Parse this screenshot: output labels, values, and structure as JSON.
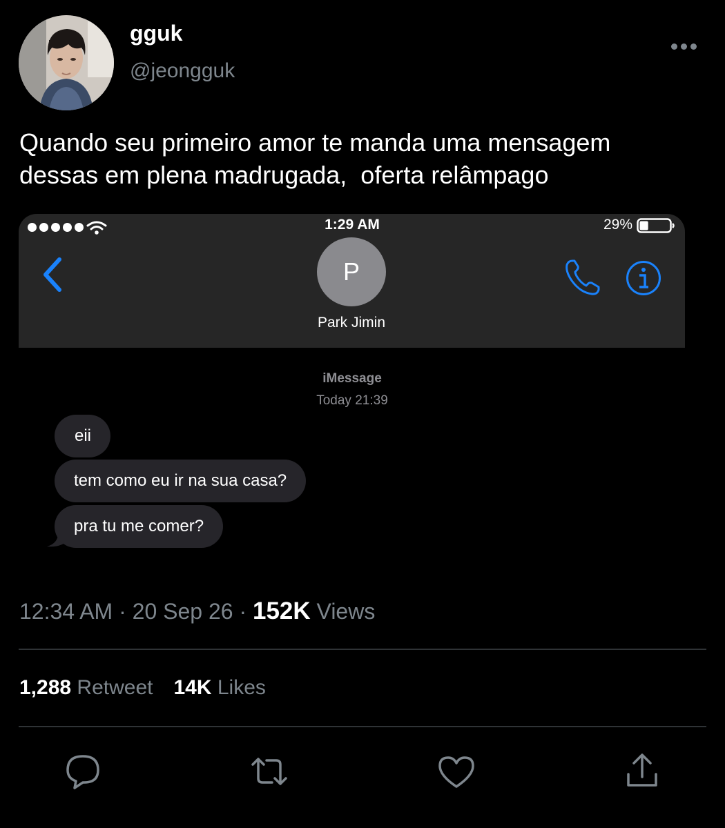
{
  "tweet": {
    "display_name": "gguk",
    "handle": "@jeongguk",
    "text": "Quando seu primeiro amor te manda uma mensagem\ndessas em plena madrugada,  oferta relâmpago",
    "timestamp": "12:34 AM · 20 Sep 26 · ",
    "views_count": "152K",
    "views_label": " Views",
    "retweets_count": "1,288",
    "retweets_label": " Retweet",
    "likes_count": "14K",
    "likes_label": " Likes"
  },
  "screenshot": {
    "status_bar": {
      "time": "1:29 AM",
      "battery_percent": "29%",
      "battery_level": 0.29,
      "signal_bars": 5
    },
    "contact": {
      "initial": "P",
      "name": "Park Jimin"
    },
    "service": "iMessage",
    "service_time": "Today 21:39",
    "messages": [
      {
        "text": "eii"
      },
      {
        "text": "tem como eu ir na sua casa?"
      },
      {
        "text": "pra tu me comer?"
      }
    ]
  },
  "colors": {
    "background": "#000000",
    "accent_blue": "#1a82fb",
    "bubble": "#26252a",
    "secondary_text": "#7e868d"
  },
  "icons": {
    "more": "more-horizontal-icon",
    "back": "chevron-left-icon",
    "phone": "phone-icon",
    "info": "info-icon",
    "reply": "reply-icon",
    "retweet": "retweet-icon",
    "like": "heart-icon",
    "share": "share-icon"
  }
}
